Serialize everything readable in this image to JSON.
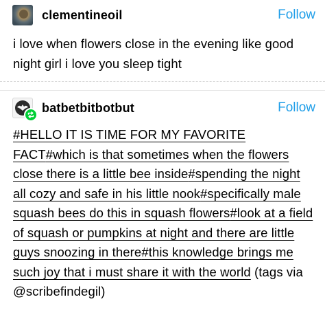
{
  "posts": [
    {
      "username": "clementineoil",
      "follow_label": "Follow",
      "text": "i love when flowers close in the evening like good night girl i love you sleep tight"
    },
    {
      "username": "batbetbitbotbut",
      "follow_label": "Follow",
      "tags": [
        "#HELLO IT IS TIME FOR MY FAVORITE FACT",
        "#which is that sometimes when the flowers close there is a little bee inside",
        "#spending the night all cozy and safe in his little nook",
        "#specifically male squash bees do this in squash flowers",
        "#look at a field of squash or pumpkins at night and there are little guys snoozing in there",
        "#this knowledge brings me such joy that i must share it with the world"
      ],
      "trailing_text": " (tags via @scribefindegil)"
    }
  ],
  "colors": {
    "follow": "#1f9ee8",
    "reblog_badge": "#00cf35"
  },
  "icons": {
    "reblog_badge": "reblog-icon"
  }
}
